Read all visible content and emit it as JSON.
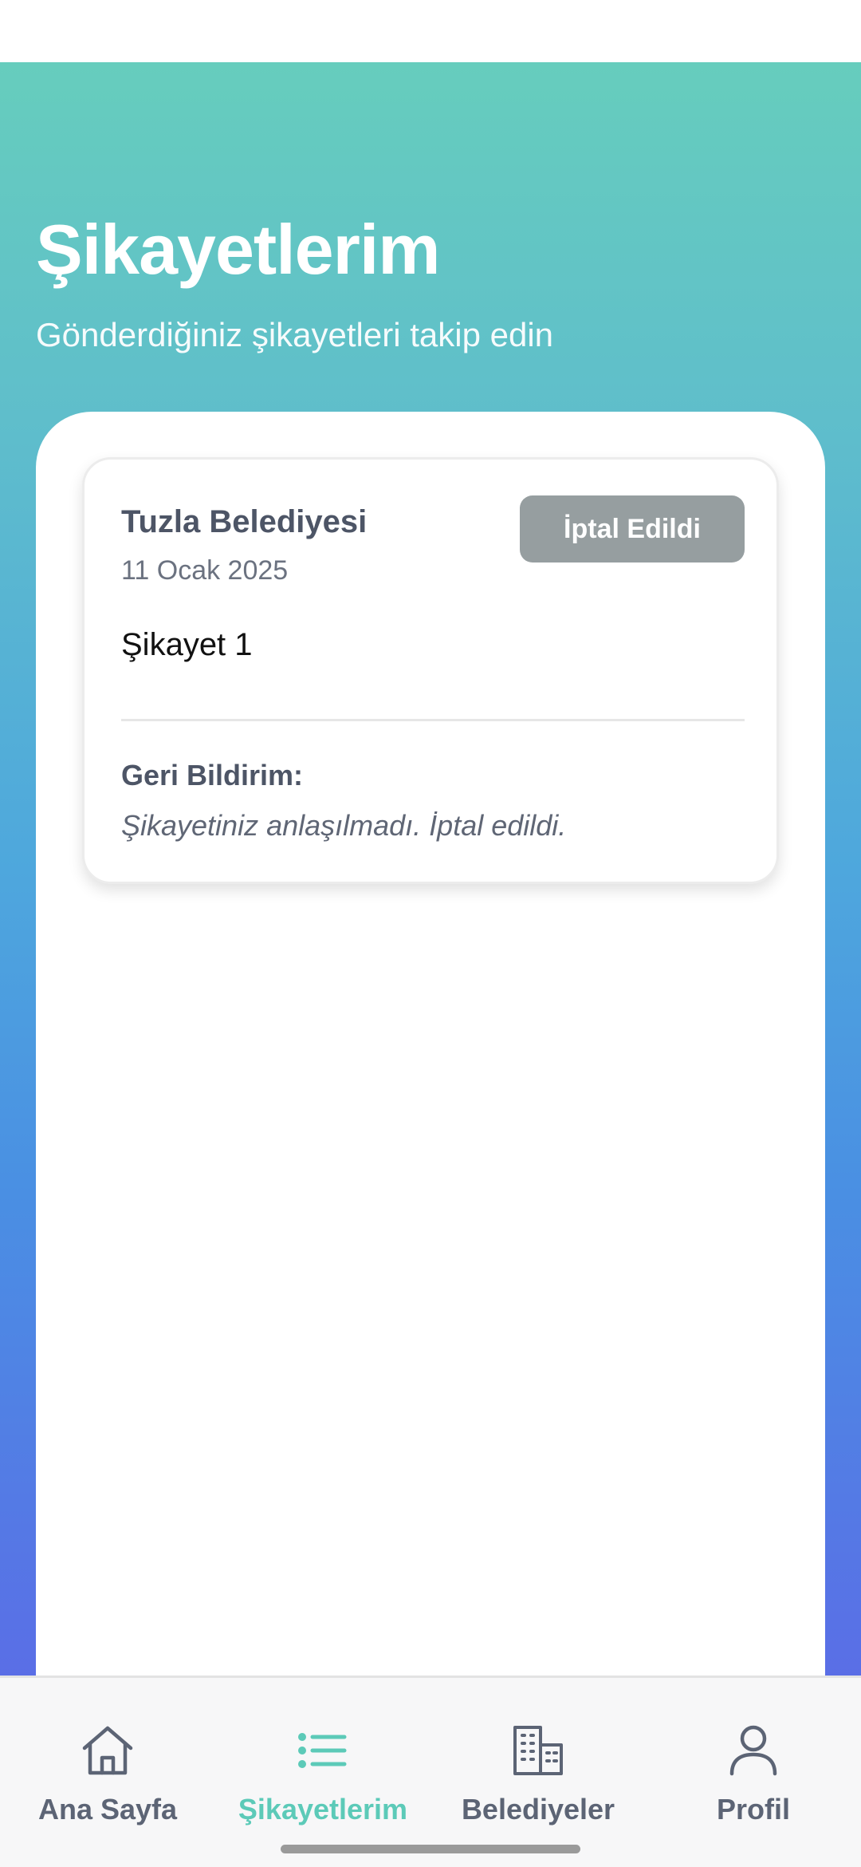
{
  "header": {
    "title": "Şikayetlerim",
    "subtitle": "Gönderdiğiniz şikayetleri takip edin"
  },
  "complaints": [
    {
      "municipality": "Tuzla Belediyesi",
      "date": "11 Ocak 2025",
      "status": "İptal Edildi",
      "status_color": "#969ea0",
      "title": "Şikayet 1",
      "feedback_label": "Geri Bildirim:",
      "feedback_text": "Şikayetiniz anlaşılmadı. İptal edildi."
    }
  ],
  "bottom_nav": {
    "items": [
      {
        "label": "Ana Sayfa",
        "icon": "home-icon",
        "active": false
      },
      {
        "label": "Şikayetlerim",
        "icon": "list-icon",
        "active": true
      },
      {
        "label": "Belediyeler",
        "icon": "building-icon",
        "active": false
      },
      {
        "label": "Profil",
        "icon": "profile-icon",
        "active": false
      }
    ]
  },
  "colors": {
    "accent": "#5ccab8",
    "gradient_top": "#66cdbd",
    "gradient_bottom": "#5a6ee6",
    "nav_inactive": "#5c6475"
  }
}
